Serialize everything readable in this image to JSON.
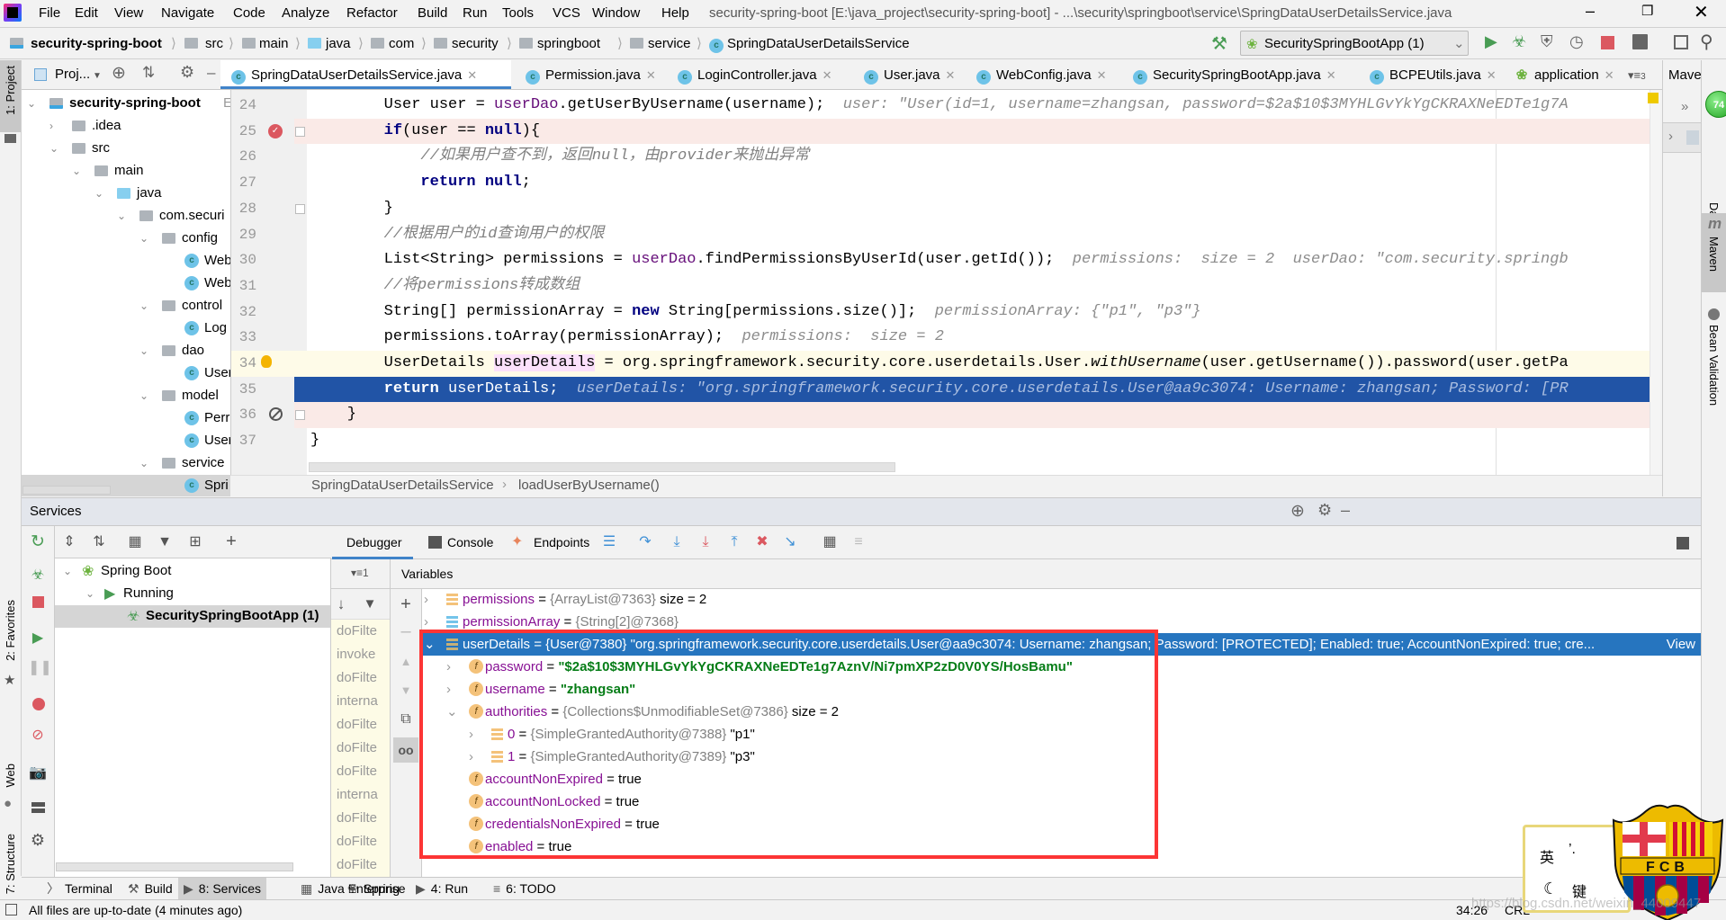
{
  "window": {
    "title": "security-spring-boot [E:\\java_project\\security-spring-boot] - ...\\security\\springboot\\service\\SpringDataUserDetailsService.java"
  },
  "menu": [
    "File",
    "Edit",
    "View",
    "Navigate",
    "Code",
    "Analyze",
    "Refactor",
    "Build",
    "Run",
    "Tools",
    "VCS",
    "Window",
    "Help"
  ],
  "navbar": {
    "crumbs": [
      "security-spring-boot",
      "src",
      "main",
      "java",
      "com",
      "security",
      "springboot",
      "service",
      "SpringDataUserDetailsService"
    ],
    "run_config": "SecuritySpringBootApp (1)"
  },
  "left_strip": [
    "1: Project",
    "2: Favorites",
    "Web",
    "7: Structure"
  ],
  "project": {
    "title": "Proj...",
    "tree": [
      {
        "label": "security-spring-boot",
        "suffix": "E:\\",
        "level": 0,
        "arrow": "down",
        "icon": "module",
        "bold": true
      },
      {
        "label": ".idea",
        "level": 1,
        "arrow": "right",
        "icon": "folder"
      },
      {
        "label": "src",
        "level": 1,
        "arrow": "down",
        "icon": "folder"
      },
      {
        "label": "main",
        "level": 2,
        "arrow": "down",
        "icon": "folder"
      },
      {
        "label": "java",
        "level": 3,
        "arrow": "down",
        "icon": "source-folder"
      },
      {
        "label": "com.securi",
        "level": 4,
        "arrow": "down",
        "icon": "package"
      },
      {
        "label": "config",
        "level": 5,
        "arrow": "down",
        "icon": "package"
      },
      {
        "label": "Web",
        "level": 6,
        "icon": "class"
      },
      {
        "label": "Web",
        "level": 6,
        "icon": "class"
      },
      {
        "label": "control",
        "level": 5,
        "arrow": "down",
        "icon": "package"
      },
      {
        "label": "Log",
        "level": 6,
        "icon": "class"
      },
      {
        "label": "dao",
        "level": 5,
        "arrow": "down",
        "icon": "package"
      },
      {
        "label": "User",
        "level": 6,
        "icon": "class"
      },
      {
        "label": "model",
        "level": 5,
        "arrow": "down",
        "icon": "package"
      },
      {
        "label": "Perr",
        "level": 6,
        "icon": "class"
      },
      {
        "label": "User",
        "level": 6,
        "icon": "class"
      },
      {
        "label": "service",
        "level": 5,
        "arrow": "down",
        "icon": "package"
      },
      {
        "label": "Spri",
        "level": 6,
        "icon": "class",
        "selected": true
      }
    ]
  },
  "tabs": [
    {
      "label": "SpringDataUserDetailsService.java",
      "icon": "class",
      "active": true
    },
    {
      "label": "Permission.java",
      "icon": "class"
    },
    {
      "label": "LoginController.java",
      "icon": "class"
    },
    {
      "label": "User.java",
      "icon": "class"
    },
    {
      "label": "WebConfig.java",
      "icon": "class"
    },
    {
      "label": "SecuritySpringBootApp.java",
      "icon": "spring-class"
    },
    {
      "label": "BCPEUtils.java",
      "icon": "class"
    },
    {
      "label": "application",
      "icon": "spring-config"
    }
  ],
  "tabs_more": "3",
  "editor": {
    "lines": [
      {
        "n": "24",
        "bg": "",
        "tokens": [
          [
            "        User user = ",
            ""
          ],
          [
            "userDao",
            "field"
          ],
          [
            ".getUserByUsername(username);",
            ""
          ],
          [
            "  user: \"User(id=1, username=zhangsan, password=$2a$10$3MYHLGvYkYgCKRAXNeEDTe1g7A",
            "hint"
          ]
        ]
      },
      {
        "n": "25",
        "bg": "pink",
        "marker": "breakpoint",
        "tokens": [
          [
            "        ",
            ""
          ],
          [
            "if",
            "kw"
          ],
          [
            "(user == ",
            ""
          ],
          [
            "null",
            "kw"
          ],
          [
            "){",
            ""
          ]
        ]
      },
      {
        "n": "26",
        "bg": "",
        "tokens": [
          [
            "            ",
            ""
          ],
          [
            "//如果用户查不到，返回null，由provider来抛出异常",
            "cm"
          ]
        ]
      },
      {
        "n": "27",
        "bg": "",
        "tokens": [
          [
            "            ",
            ""
          ],
          [
            "return",
            "kw"
          ],
          [
            " ",
            ""
          ],
          [
            "null",
            "kw"
          ],
          [
            ";",
            ""
          ]
        ]
      },
      {
        "n": "28",
        "bg": "",
        "tokens": [
          [
            "        }",
            ""
          ]
        ]
      },
      {
        "n": "29",
        "bg": "",
        "tokens": [
          [
            "        ",
            ""
          ],
          [
            "//根据用户的id查询用户的权限",
            "cm"
          ]
        ]
      },
      {
        "n": "30",
        "bg": "",
        "tokens": [
          [
            "        List<String> permissions = ",
            ""
          ],
          [
            "userDao",
            "field"
          ],
          [
            ".findPermissionsByUserId(user.getId());",
            ""
          ],
          [
            "  permissions:  size = 2  userDao: \"com.security.springb",
            "hint"
          ]
        ]
      },
      {
        "n": "31",
        "bg": "",
        "tokens": [
          [
            "        ",
            ""
          ],
          [
            "//将permissions转成数组",
            "cm"
          ]
        ]
      },
      {
        "n": "32",
        "bg": "",
        "tokens": [
          [
            "        String[] permissionArray = ",
            ""
          ],
          [
            "new",
            "kw"
          ],
          [
            " String[permissions.size()];",
            ""
          ],
          [
            "  permissionArray: {\"p1\", \"p3\"}",
            "hint"
          ]
        ]
      },
      {
        "n": "33",
        "bg": "",
        "tokens": [
          [
            "        permissions.toArray(permissionArray);",
            ""
          ],
          [
            "  permissions:  size = 2",
            "hint"
          ]
        ]
      },
      {
        "n": "34",
        "bg": "yellow",
        "marker": "bulb",
        "tokens": [
          [
            "        UserDetails ",
            ""
          ],
          [
            "userDetails",
            "hl"
          ],
          [
            " = org.springframework.security.core.userdetails.User.",
            ""
          ],
          [
            "withUsername",
            "it"
          ],
          [
            "(user.getUsername()).password(user.getPa",
            ""
          ]
        ]
      },
      {
        "n": "35",
        "bg": "blue",
        "tokens": [
          [
            "        ",
            ""
          ],
          [
            "return",
            "kw"
          ],
          [
            " userDetails;",
            ""
          ],
          [
            "  userDetails: \"org.springframework.security.core.userdetails.User@aa9c3074: Username: zhangsan; Password: [PR",
            "hint"
          ]
        ]
      },
      {
        "n": "36",
        "bg": "pink",
        "marker": "disabled",
        "tokens": [
          [
            "    }",
            ""
          ]
        ]
      },
      {
        "n": "37",
        "bg": "",
        "tokens": [
          [
            "}",
            ""
          ]
        ]
      }
    ],
    "breadcrumb": [
      "SpringDataUserDetailsService",
      "loadUserByUsername()"
    ]
  },
  "right": {
    "maven_header": "Mave",
    "memory_badge": "74",
    "tools": [
      "Database",
      "Maven",
      "Bean Validation"
    ]
  },
  "services": {
    "title": "Services",
    "tree": [
      {
        "label": "Spring Boot",
        "level": 0,
        "arrow": "down",
        "icon": "spring"
      },
      {
        "label": "Running",
        "level": 1,
        "arrow": "down",
        "icon": "play"
      },
      {
        "label": "SecuritySpringBootApp (1)",
        "level": 2,
        "icon": "bug",
        "bold": true,
        "selected": true
      }
    ]
  },
  "debugger": {
    "tabs": [
      "Debugger",
      "Console",
      "Endpoints"
    ],
    "threads_label": "1",
    "variables_label": "Variables",
    "frames": [
      "doFilte",
      "invoke",
      "doFilte",
      "interna",
      "doFilte",
      "doFilte",
      "doFilte",
      "interna",
      "doFilte",
      "doFilte",
      "doFilte"
    ],
    "variables": [
      {
        "level": 0,
        "arrow": "right",
        "icon": "list",
        "name": "permissions",
        "eq": " = ",
        "type": "{ArrayList@7363}",
        "value": "  size = 2"
      },
      {
        "level": 0,
        "arrow": "right",
        "icon": "array",
        "name": "permissionArray",
        "eq": " = ",
        "type": "{String[2]@7368}",
        "value": ""
      },
      {
        "level": 0,
        "arrow": "down",
        "icon": "list",
        "name": "userDetails",
        "eq": " = ",
        "type": "{User@7380}",
        "value": " \"org.springframework.security.core.userdetails.User@aa9c3074: Username: zhangsan; Password: [PROTECTED]; Enabled: true; AccountNonExpired: true; cre...",
        "link": "View",
        "selected": true
      },
      {
        "level": 1,
        "arrow": "right",
        "icon": "field",
        "name": "password",
        "eq": " = ",
        "type": "",
        "value": "\"$2a$10$3MYHLGvYkYgCKRAXNeEDTe1g7AznV/Ni7pmXP2zD0V0YS/HosBamu\"",
        "string": true
      },
      {
        "level": 1,
        "arrow": "right",
        "icon": "field",
        "name": "username",
        "eq": " = ",
        "type": "",
        "value": "\"zhangsan\"",
        "string": true
      },
      {
        "level": 1,
        "arrow": "down",
        "icon": "field",
        "name": "authorities",
        "eq": " = ",
        "type": "{Collections$UnmodifiableSet@7386}",
        "value": "  size = 2"
      },
      {
        "level": 2,
        "arrow": "right",
        "icon": "list",
        "name": "0",
        "eq": " = ",
        "type": "{SimpleGrantedAuthority@7388}",
        "value": " \"p1\""
      },
      {
        "level": 2,
        "arrow": "right",
        "icon": "list",
        "name": "1",
        "eq": " = ",
        "type": "{SimpleGrantedAuthority@7389}",
        "value": " \"p3\""
      },
      {
        "level": 1,
        "icon": "field",
        "name": "accountNonExpired",
        "eq": " = ",
        "type": "",
        "value": "true"
      },
      {
        "level": 1,
        "icon": "field",
        "name": "accountNonLocked",
        "eq": " = ",
        "type": "",
        "value": "true"
      },
      {
        "level": 1,
        "icon": "field",
        "name": "credentialsNonExpired",
        "eq": " = ",
        "type": "",
        "value": "true"
      },
      {
        "level": 1,
        "icon": "field",
        "name": "enabled",
        "eq": " = ",
        "type": "",
        "value": "true"
      }
    ]
  },
  "bottom_tabs": [
    {
      "label": "Terminal",
      "icon": "terminal"
    },
    {
      "label": "Build",
      "icon": "hammer"
    },
    {
      "label": "8: Services",
      "icon": "services",
      "selected": true
    },
    {
      "label": "Java Enterprise",
      "icon": "java-enterprise"
    },
    {
      "label": "Spring",
      "icon": "spring"
    },
    {
      "label": "4: Run",
      "icon": "run"
    },
    {
      "label": "6: TODO",
      "icon": "todo"
    }
  ],
  "status": {
    "message": "All files are up-to-date (4 minutes ago)",
    "position": "34:26",
    "line_sep": "CRL"
  },
  "overlay": {
    "ime_top": "英",
    "ime_punct": "’.",
    "ime_bottom": "键",
    "logo_text": "FCB",
    "watermark": "https://blog.csdn.net/weixin_44009447"
  },
  "colors": {
    "accent": "#4083c9",
    "selection": "#2675bf",
    "execution_line": "#2154a6",
    "breakpoint": "#db5860",
    "highlight_box": "#fc3535",
    "run_green": "#59a869"
  }
}
